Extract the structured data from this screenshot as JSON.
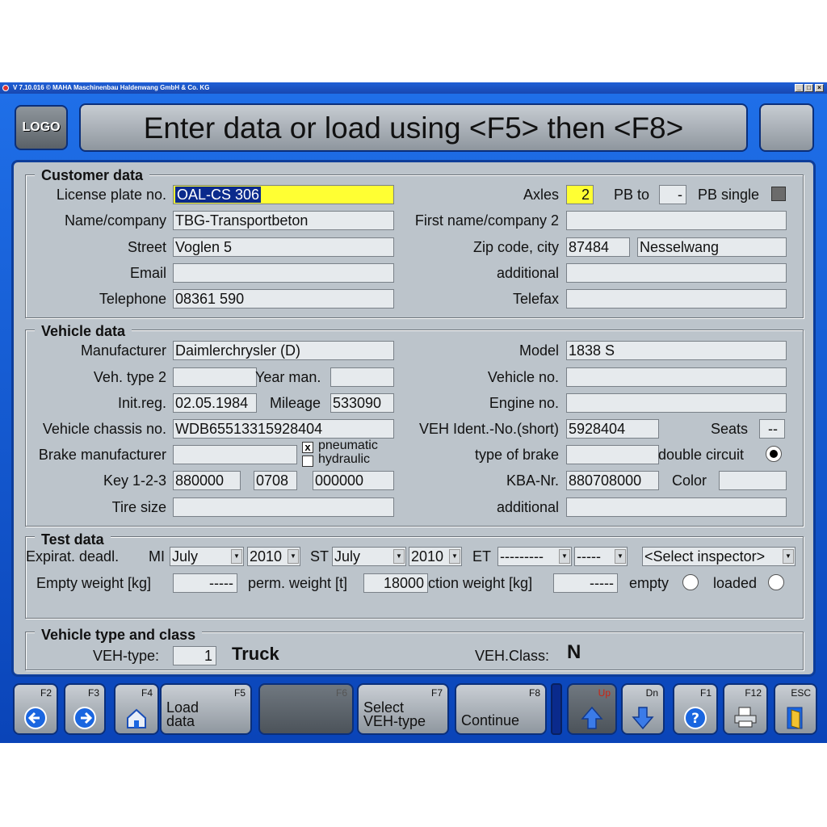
{
  "window": {
    "title": "V 7.10.016  © MAHA Maschinenbau Haldenwang GmbH & Co. KG",
    "min": "_",
    "max": "□",
    "close": "×"
  },
  "header": {
    "logo": "LOGO",
    "title": "Enter data or load using <F5> then <F8>"
  },
  "customer": {
    "title": "Customer data",
    "license_label": "License plate no.",
    "license_value": "OAL-CS 306",
    "axles_label": "Axles",
    "axles_value": "2",
    "pbto_label": "PB to",
    "pbto_value": "-",
    "pbsingle_label": "PB single",
    "name_label": "Name/company",
    "name_value": "TBG-Transportbeton",
    "first_label": "First name/company 2",
    "first_value": "",
    "street_label": "Street",
    "street_value": "Voglen 5",
    "zip_label": "Zip code, city",
    "zip_value": "87484",
    "city_value": "Nesselwang",
    "email_label": "Email",
    "email_value": "",
    "additional_label": "additional",
    "additional_value": "",
    "phone_label": "Telephone",
    "phone_value": "08361 590",
    "fax_label": "Telefax",
    "fax_value": ""
  },
  "vehicle": {
    "title": "Vehicle data",
    "manufacturer_label": "Manufacturer",
    "manufacturer_value": "Daimlerchrysler (D)",
    "model_label": "Model",
    "model_value": "1838 S",
    "vehtype2_label": "Veh. type 2",
    "vehtype2_value": "",
    "yearman_label": "Year man.",
    "yearman_value": "",
    "vehicleno_label": "Vehicle no.",
    "vehicleno_value": "",
    "initreg_label": "Init.reg.",
    "initreg_value": "02.05.1984",
    "mileage_label": "Mileage",
    "mileage_value": "533090",
    "engine_label": "Engine no.",
    "engine_value": "",
    "chassis_label": "Vehicle chassis no.",
    "chassis_value": "WDB65513315928404",
    "ident_label": "VEH Ident.-No.(short)",
    "ident_value": "5928404",
    "seats_label": "Seats",
    "seats_value": "--",
    "brake_label": "Brake manufacturer",
    "brake_value": "",
    "pneumatic_label": "pneumatic",
    "hydraulic_label": "hydraulic",
    "pneumatic_mark": "x",
    "hydraulic_mark": "",
    "typebrake_label": "type of brake",
    "typebrake_value": "",
    "double_label": "double circuit",
    "key_label": "Key 1-2-3",
    "key1": "880000",
    "key2": "0708",
    "key3": "000000",
    "kba_label": "KBA-Nr.",
    "kba_value": "880708000",
    "color_label": "Color",
    "color_value": "",
    "tire_label": "Tire size",
    "tire_value": "",
    "additional_label": "additional",
    "additional_value": ""
  },
  "test": {
    "title": "Test data",
    "expirat_label": "Expirat. deadl.",
    "mi_label": "MI",
    "mi_month": "July",
    "mi_year": "2010",
    "st_label": "ST",
    "st_month": "July",
    "st_year": "2010",
    "et_label": "ET",
    "et_month": "---------",
    "et_year": "-----",
    "inspector": "<Select inspector>",
    "empty_weight_label": "Empty weight [kg]",
    "empty_weight_value": "-----",
    "perm_label": "perm. weight [t]",
    "perm_value": "18000",
    "action_label": "ction weight [kg]",
    "action_value": "-----",
    "empty_label": "empty",
    "loaded_label": "loaded"
  },
  "vclass": {
    "title": "Vehicle type and class",
    "type_label": "VEH-type:",
    "type_value": "1",
    "type_name": "Truck",
    "class_label": "VEH.Class:",
    "class_value": "N"
  },
  "fkeys": {
    "f2": "F2",
    "f3": "F3",
    "f4": "F4",
    "f5": "F5",
    "f5_l1": "Load",
    "f5_l2": "data",
    "f6": "F6",
    "f7": "F7",
    "f7_l1": "Select",
    "f7_l2": "VEH-type",
    "f8": "F8",
    "f8_l1": "Continue",
    "up": "Up",
    "dn": "Dn",
    "f1": "F1",
    "f12": "F12",
    "esc": "ESC"
  }
}
